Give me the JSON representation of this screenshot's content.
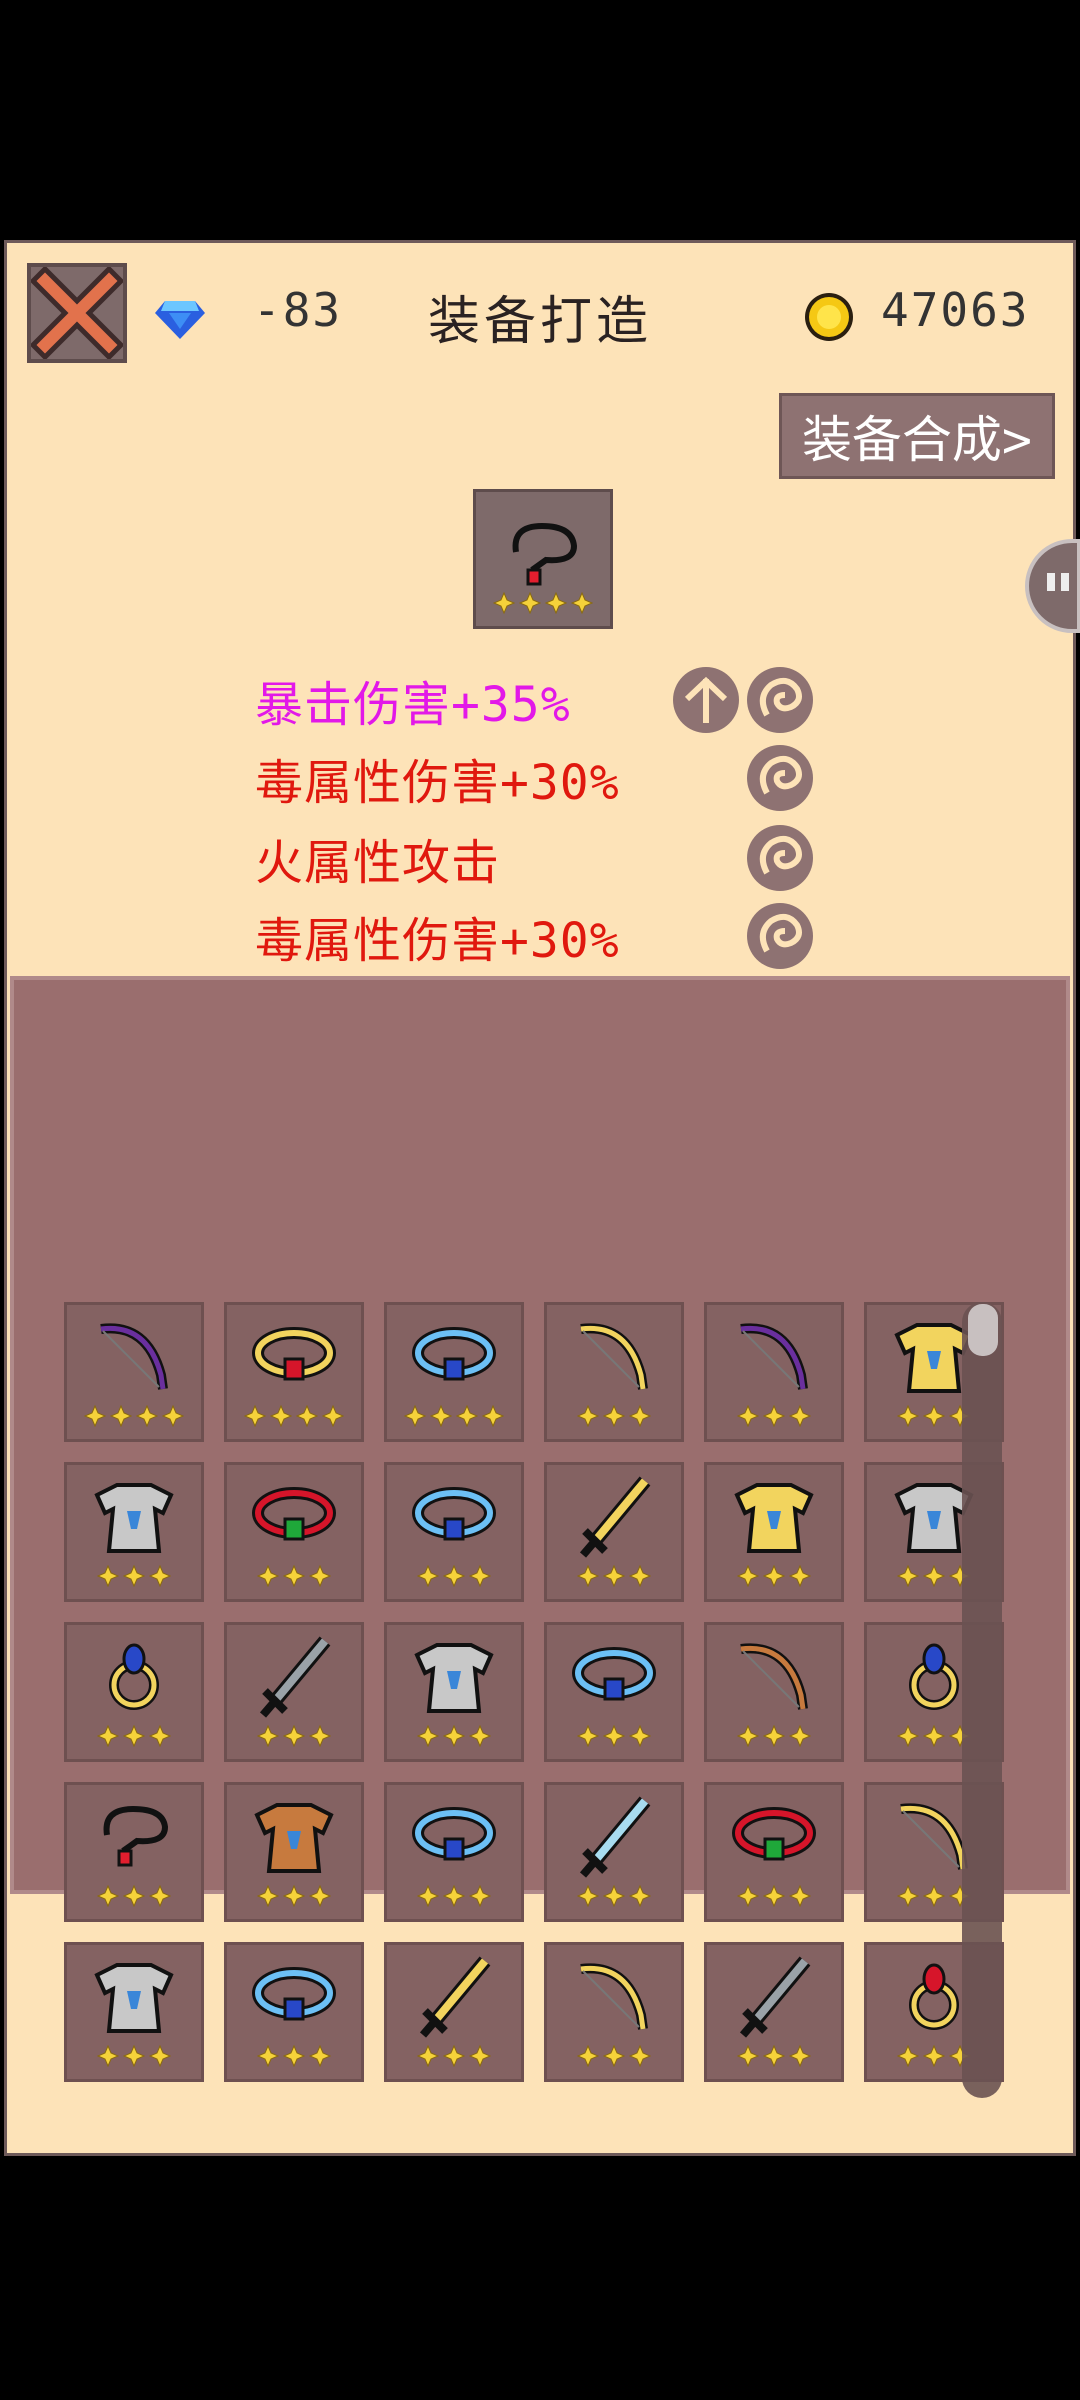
{
  "header": {
    "title": "装备打造",
    "gem_count": "-83",
    "gold_count": "47063",
    "close_icon": "close-icon",
    "gem_icon": "diamond-icon",
    "gold_icon": "coin-icon"
  },
  "synth_button": {
    "label": "装备合成>"
  },
  "selected_item": {
    "type": "pendant",
    "stars": 4
  },
  "attributes": [
    {
      "text": "暴击伤害+35%",
      "color": "#e218e8",
      "buttons": [
        "upgrade-icon",
        "swirl-icon"
      ]
    },
    {
      "text": "毒属性伤害+30%",
      "color": "#e0180e",
      "buttons": [
        "swirl-icon"
      ]
    },
    {
      "text": "火属性攻击",
      "color": "#e0180e",
      "buttons": [
        "swirl-icon"
      ]
    },
    {
      "text": "毒属性伤害+30%",
      "color": "#e0180e",
      "buttons": [
        "swirl-icon"
      ]
    }
  ],
  "inventory": {
    "rows": [
      [
        {
          "type": "bow",
          "color": "purple",
          "stars": 4
        },
        {
          "type": "ring",
          "color": "gold-ruby",
          "stars": 4
        },
        {
          "type": "ring",
          "color": "blue",
          "stars": 4
        },
        {
          "type": "bow",
          "color": "gold",
          "stars": 3
        },
        {
          "type": "bow",
          "color": "purple",
          "stars": 3
        },
        {
          "type": "armor",
          "color": "gold",
          "stars": 3
        }
      ],
      [
        {
          "type": "armor",
          "color": "silver",
          "stars": 3
        },
        {
          "type": "ring",
          "color": "red-emerald",
          "stars": 3
        },
        {
          "type": "ring",
          "color": "blue",
          "stars": 3
        },
        {
          "type": "sword",
          "color": "gold",
          "stars": 3
        },
        {
          "type": "armor",
          "color": "gold",
          "stars": 3
        },
        {
          "type": "armor",
          "color": "silver",
          "stars": 3
        }
      ],
      [
        {
          "type": "ring",
          "color": "gold-sapphire",
          "stars": 3
        },
        {
          "type": "sword",
          "color": "steel",
          "stars": 3
        },
        {
          "type": "armor",
          "color": "silver",
          "stars": 3
        },
        {
          "type": "ring",
          "color": "blue",
          "stars": 3
        },
        {
          "type": "bow",
          "color": "bronze",
          "stars": 3
        },
        {
          "type": "ring",
          "color": "gold-sapphire",
          "stars": 3
        }
      ],
      [
        {
          "type": "pendant",
          "color": "black",
          "stars": 3
        },
        {
          "type": "armor",
          "color": "bronze",
          "stars": 3
        },
        {
          "type": "ring",
          "color": "blue",
          "stars": 3
        },
        {
          "type": "sword",
          "color": "ice",
          "stars": 3
        },
        {
          "type": "ring",
          "color": "red-emerald",
          "stars": 3
        },
        {
          "type": "bow",
          "color": "gold",
          "stars": 3
        }
      ],
      [
        {
          "type": "armor",
          "color": "silver",
          "stars": 3
        },
        {
          "type": "ring",
          "color": "blue",
          "stars": 3
        },
        {
          "type": "sword",
          "color": "gold",
          "stars": 3
        },
        {
          "type": "bow",
          "color": "gold",
          "stars": 3
        },
        {
          "type": "sword",
          "color": "steel",
          "stars": 3
        },
        {
          "type": "ring",
          "color": "gold-ruby",
          "stars": 3
        }
      ]
    ]
  },
  "upgrade_button_icon": "upgrade-icon",
  "colors": {
    "panel_bg": "#fde3b8",
    "inventory_bg": "#9a6e6e",
    "slot_bg": "#846262",
    "button_bg": "#8e7272"
  }
}
